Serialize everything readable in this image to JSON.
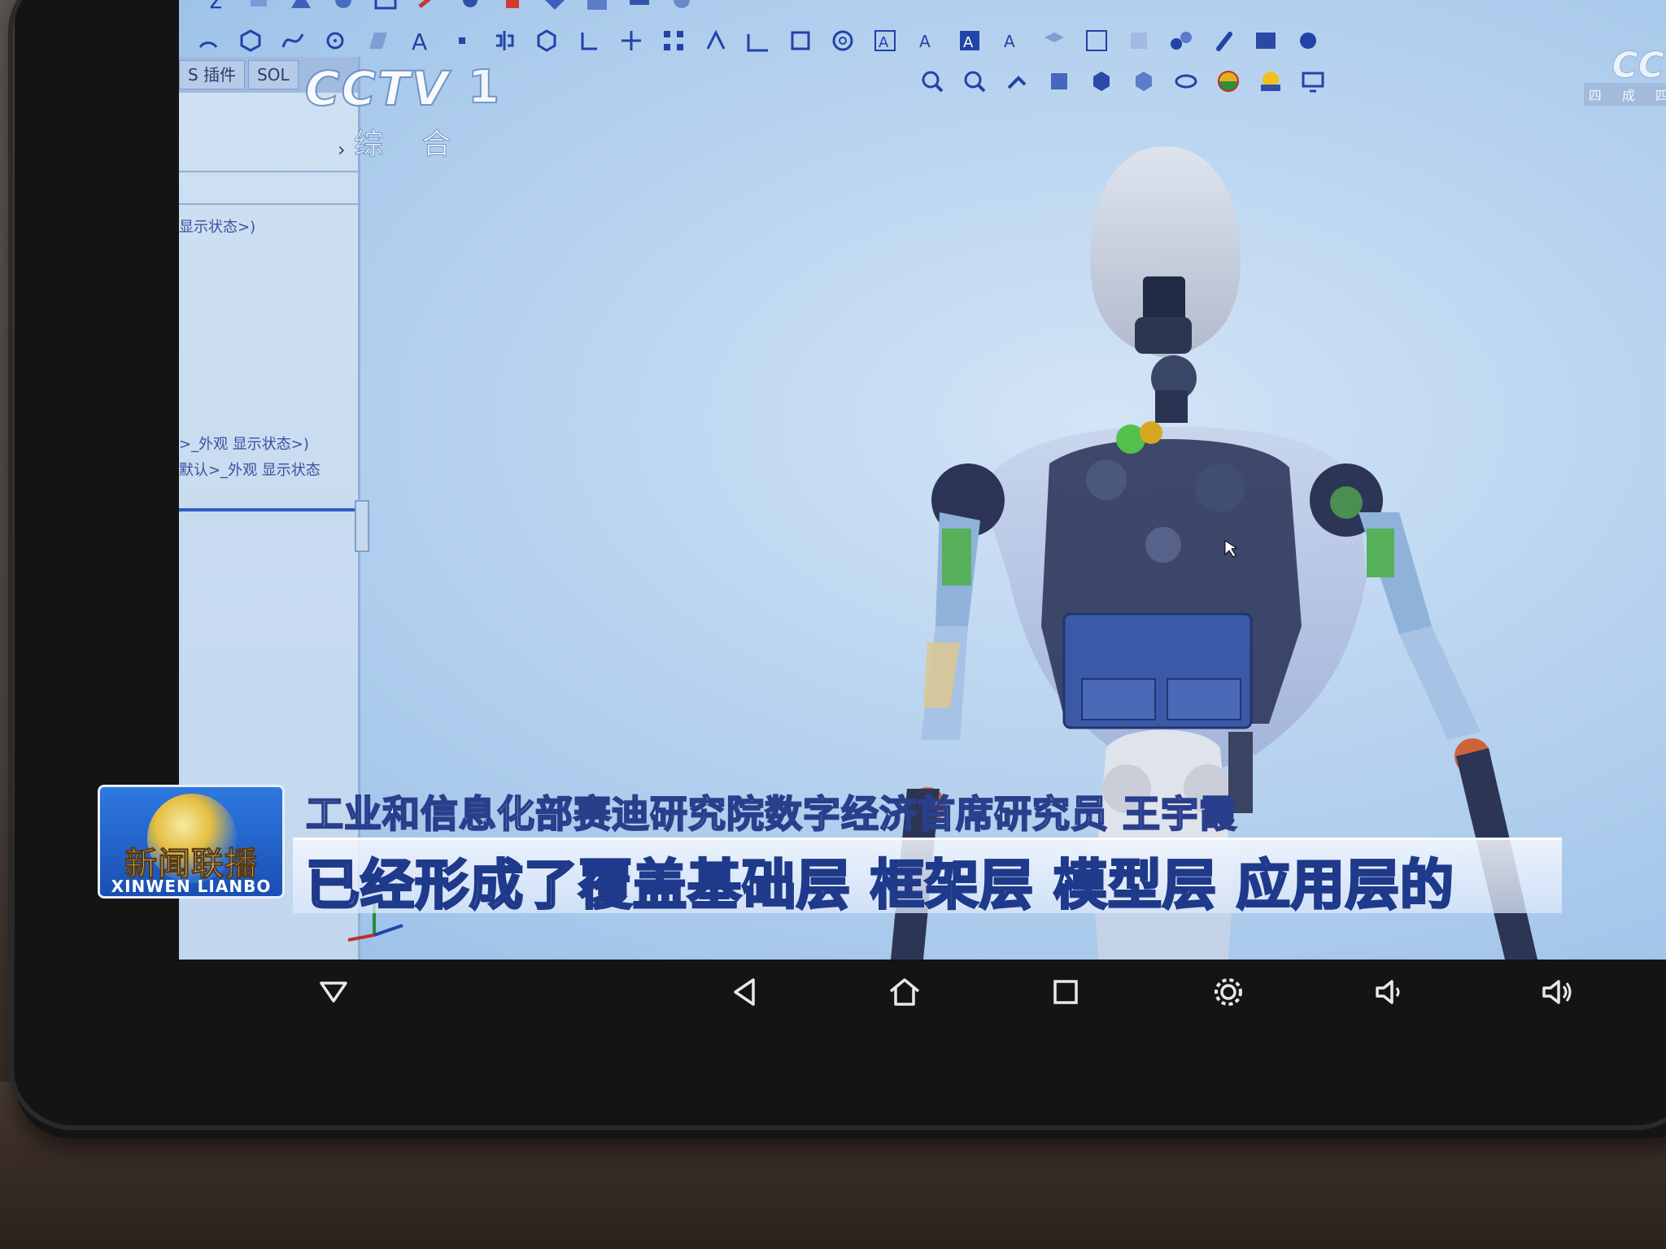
{
  "broadcast": {
    "channel_logo": "CCTV",
    "channel_number": "1",
    "channel_name": "综 合",
    "corner_logo": "CCTV",
    "corner_sub": "四 成 四 段"
  },
  "cad_app": {
    "tabs": [
      "S 插件",
      "SOL"
    ],
    "tree_items": [
      "显示状态>)",
      ">_外观 显示状态>)",
      "默认>_外观 显示状态"
    ]
  },
  "lower_third": {
    "program_logo_cn": "新闻联播",
    "program_logo_pinyin": "XINWEN LIANBO",
    "speaker_title": "工业和信息化部赛迪研究院数字经济首席研究员 王宇霞",
    "subtitle": "已经形成了覆盖基础层 框架层 模型层 应用层的"
  },
  "nav": {
    "buttons": [
      "hide-nav",
      "back",
      "home",
      "recents",
      "settings",
      "volume-down",
      "volume-up"
    ]
  },
  "colors": {
    "screen_bg": "#b8d3ef",
    "caption_stroke": "#1f3a8a",
    "news_logo_blue": "#1a4fb4"
  }
}
